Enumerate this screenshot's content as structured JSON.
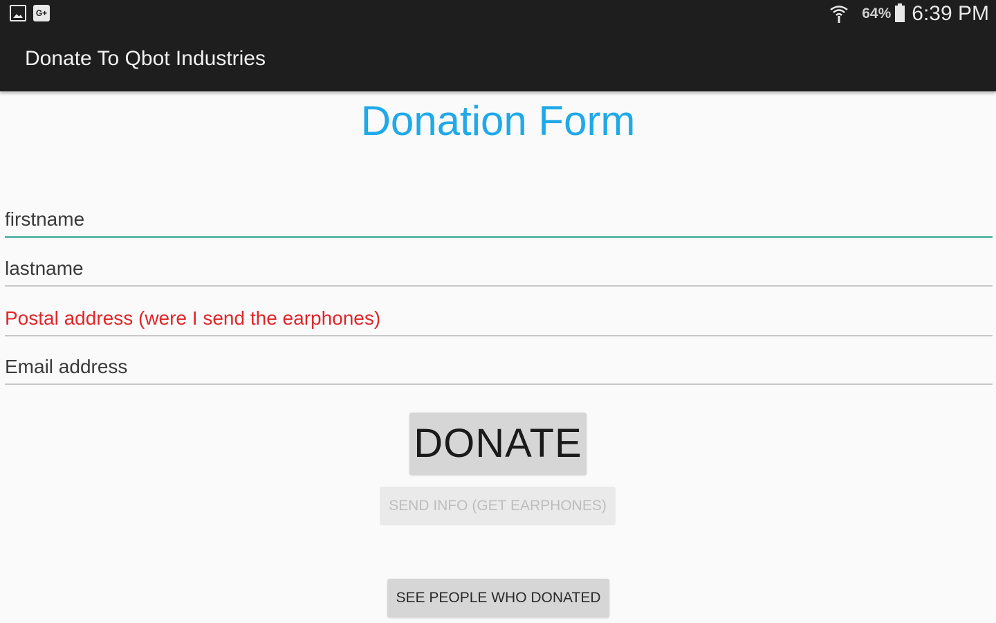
{
  "status_bar": {
    "left_icons": [
      "gallery-icon",
      "google-plus-icon"
    ],
    "google_plus_glyph": "G+",
    "battery_percent": "64%",
    "time": "6:39 PM"
  },
  "action_bar": {
    "title": "Donate To Qbot Industries"
  },
  "form": {
    "title": "Donation Form",
    "fields": [
      {
        "hint": "firstname",
        "focused": true
      },
      {
        "hint": "lastname"
      },
      {
        "hint": "Postal address (were I send the earphones)",
        "error": true
      },
      {
        "hint": "Email address"
      }
    ],
    "donate_label": "DONATE",
    "send_info_label": "SEND INFO (GET EARPHONES)",
    "send_info_enabled": false,
    "see_people_label": "SEE PEOPLE WHO DONATED"
  },
  "colors": {
    "title_blue": "#1fa9e8",
    "error_red": "#e0262a",
    "focus_teal": "#5fb8a8",
    "bar_dark": "#1e1e1e"
  }
}
